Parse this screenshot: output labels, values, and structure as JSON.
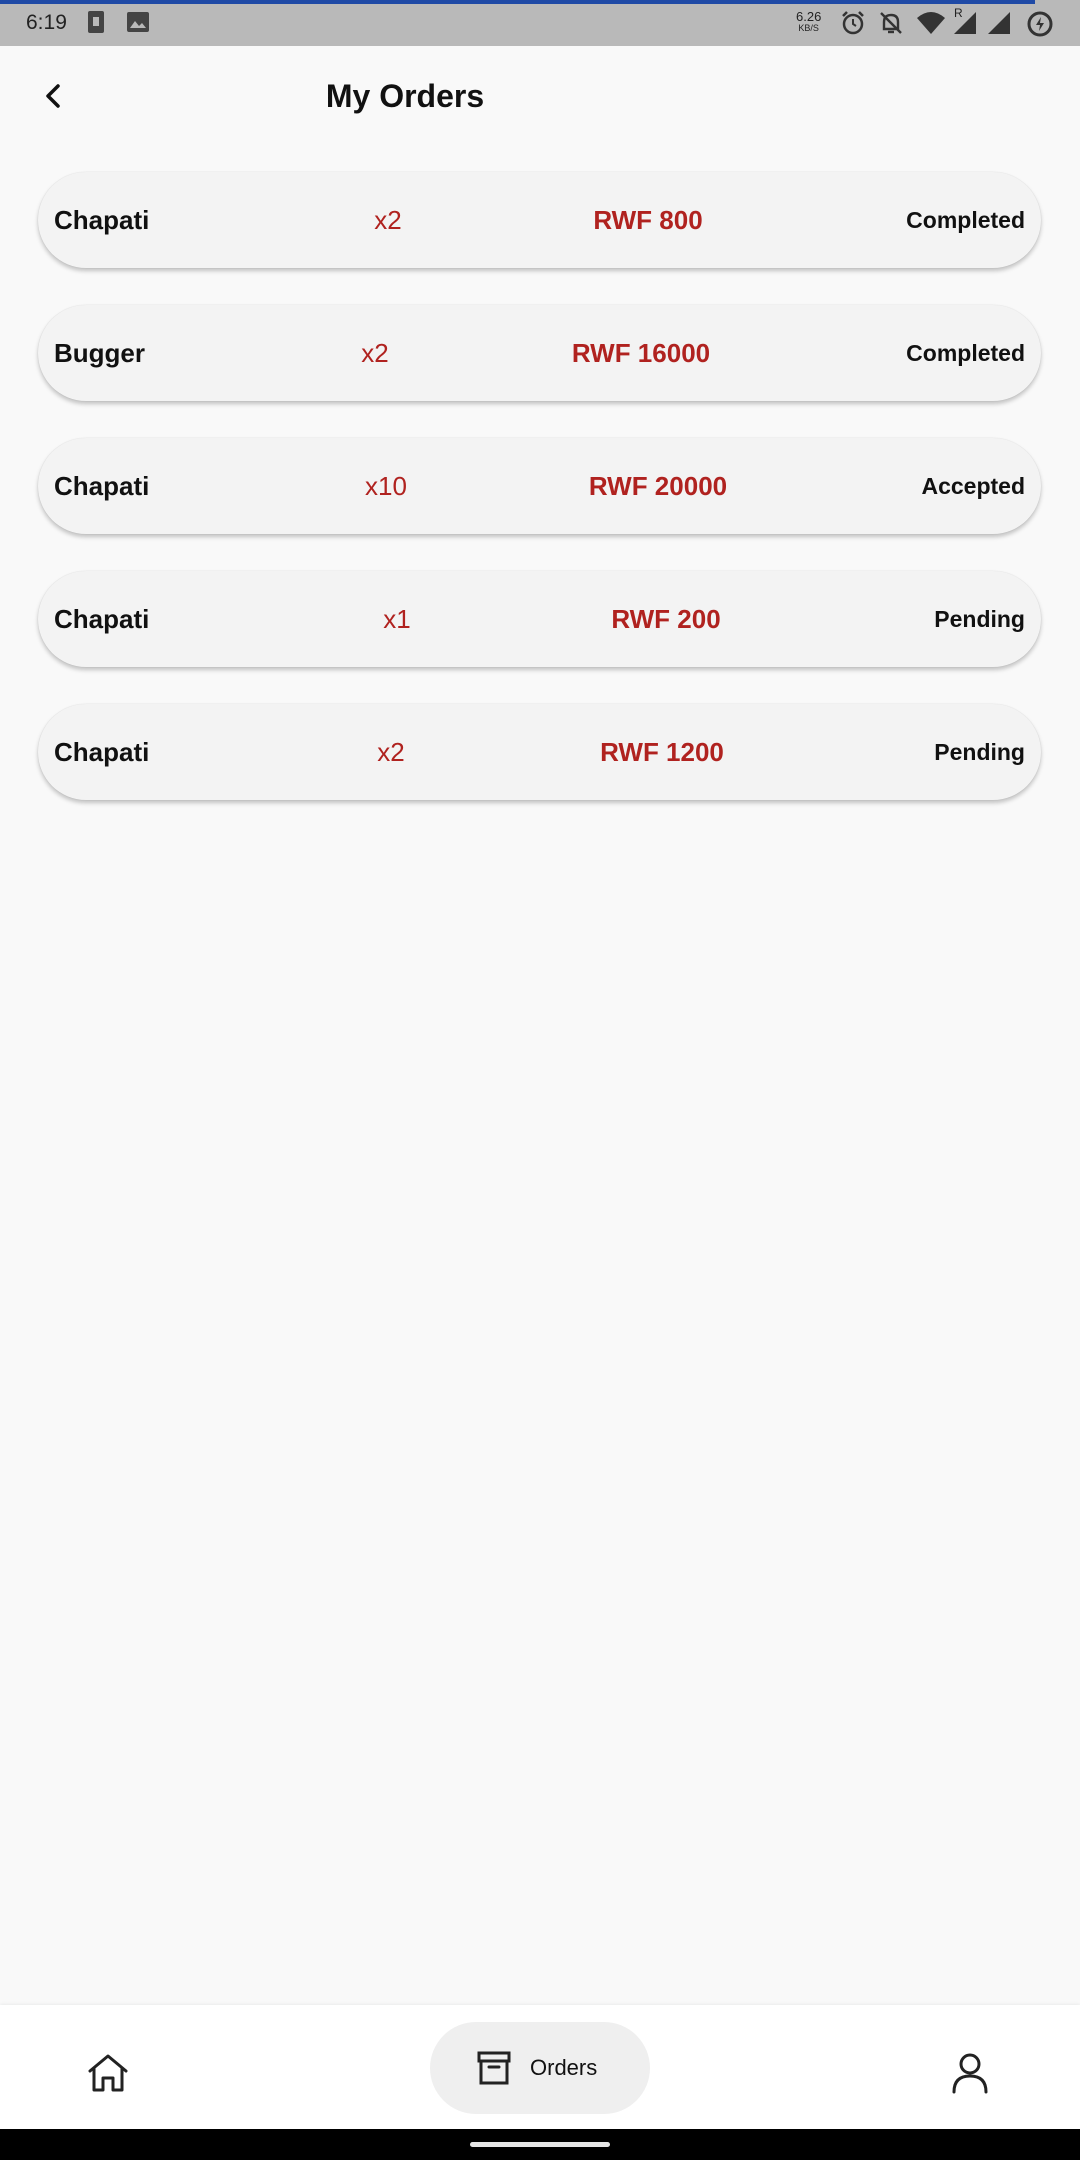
{
  "status_bar": {
    "time": "6:19",
    "net_speed_value": "6.26",
    "net_speed_unit": "KB/S",
    "signal_roaming_marker": "R"
  },
  "header": {
    "back_icon": "chevron-left-icon",
    "title": "My Orders"
  },
  "colors": {
    "accent": "#b0221f",
    "status_bar_bg": "#b9b9b9",
    "status_bar_line": "#1f4aa6",
    "page_bg": "#f9f9f9"
  },
  "orders": [
    {
      "name": "Chapati",
      "quantity": "x2",
      "price": "RWF 800",
      "status": "Completed"
    },
    {
      "name": "Bugger",
      "quantity": "x2",
      "price": "RWF 16000",
      "status": "Completed"
    },
    {
      "name": "Chapati",
      "quantity": "x10",
      "price": "RWF 20000",
      "status": "Accepted"
    },
    {
      "name": "Chapati",
      "quantity": "x1",
      "price": "RWF 200",
      "status": "Pending"
    },
    {
      "name": "Chapati",
      "quantity": "x2",
      "price": "RWF 1200",
      "status": "Pending"
    }
  ],
  "bottom_nav": {
    "items": [
      {
        "icon": "home-icon",
        "label": ""
      },
      {
        "icon": "archive-box-icon",
        "label": "Orders",
        "selected": true
      },
      {
        "icon": "user-icon",
        "label": ""
      }
    ]
  }
}
